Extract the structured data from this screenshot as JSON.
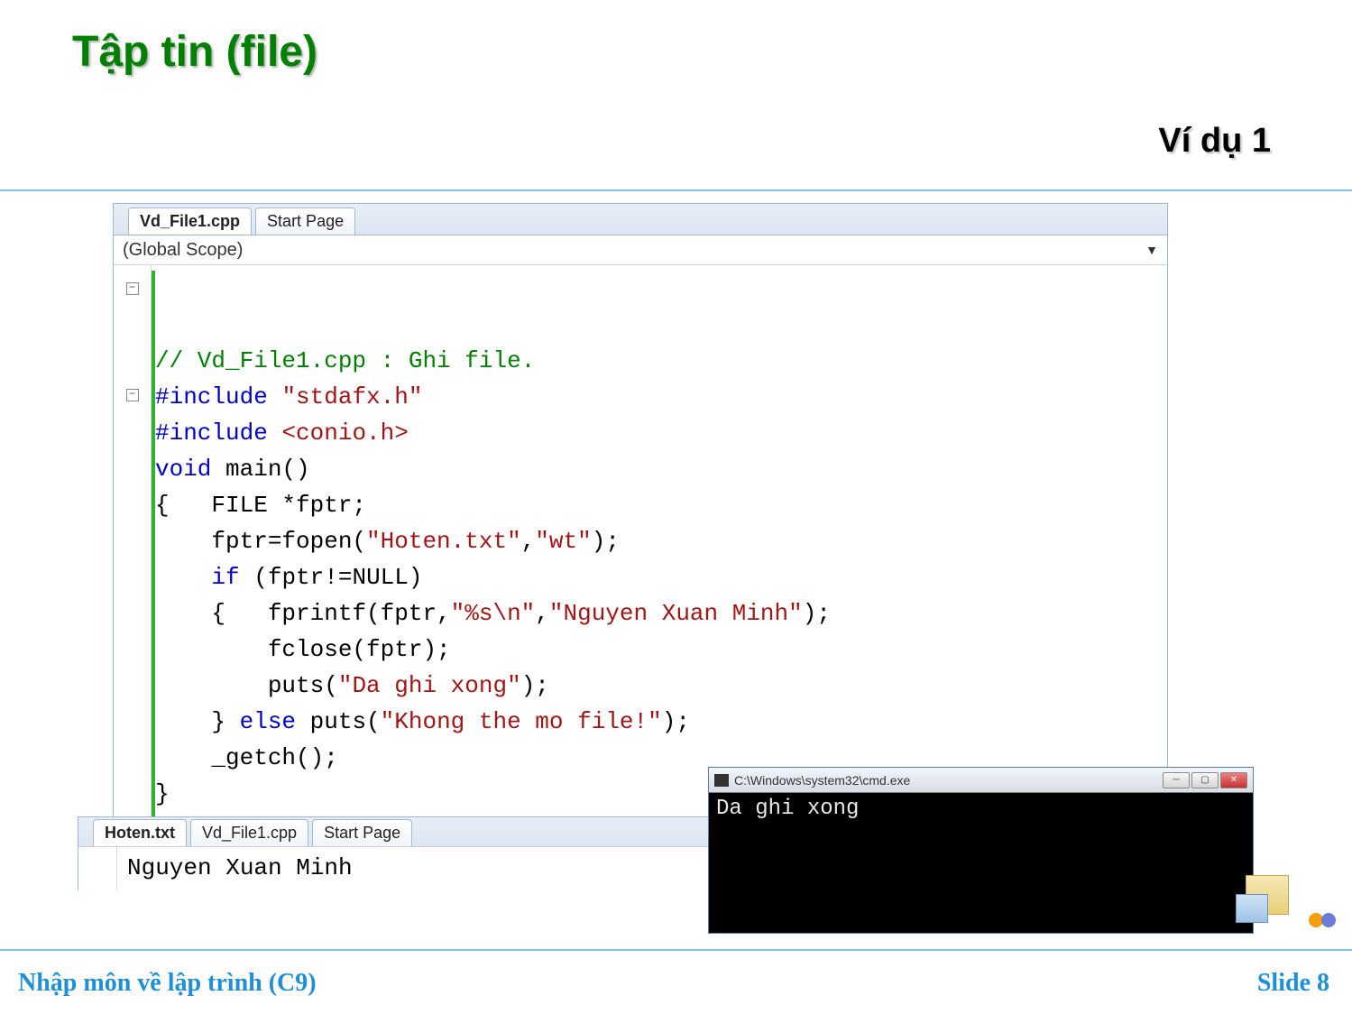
{
  "title": "Tập tin (file)",
  "subtitle": "Ví dụ 1",
  "footer": {
    "left": "Nhập môn về lập trình (C9)",
    "right": "Slide 8"
  },
  "editor1": {
    "tabs": [
      "Vd_File1.cpp",
      "Start Page"
    ],
    "activeTabIndex": 0,
    "scope": "(Global Scope)",
    "code": {
      "l1": {
        "comment": "// Vd_File1.cpp : Ghi file."
      },
      "l2": {
        "kw": "#include ",
        "str": "\"stdafx.h\""
      },
      "l3": {
        "kw": "#include ",
        "str": "<conio.h>"
      },
      "l4": {
        "kw": "void",
        "rest": " main()"
      },
      "l5": "{   FILE *fptr;",
      "l6_a": "    fptr=fopen(",
      "l6_s1": "\"Hoten.txt\"",
      "l6_b": ",",
      "l6_s2": "\"wt\"",
      "l6_c": ");",
      "l7_a": "    ",
      "l7_kw": "if",
      "l7_b": " (fptr!=NULL)",
      "l8_a": "    {   fprintf(fptr,",
      "l8_s1": "\"%s\\n\"",
      "l8_b": ",",
      "l8_s2": "\"Nguyen Xuan Minh\"",
      "l8_c": ");",
      "l9_a": "        fclose(fptr);",
      "l10_a": "        puts(",
      "l10_s": "\"Da ghi xong\"",
      "l10_b": ");",
      "l11_a": "    } ",
      "l11_kw": "else",
      "l11_b": " puts(",
      "l11_s": "\"Khong the mo file!\"",
      "l11_c": ");",
      "l12": "    _getch();",
      "l13": "}"
    }
  },
  "editor2": {
    "tabs": [
      "Hoten.txt",
      "Vd_File1.cpp",
      "Start Page"
    ],
    "activeTabIndex": 0,
    "content": "Nguyen Xuan Minh"
  },
  "console": {
    "title": "C:\\Windows\\system32\\cmd.exe",
    "output": "Da ghi xong"
  },
  "icons": {
    "dropdown": "▼",
    "min": "─",
    "max": "▢",
    "close": "✕",
    "foldMinus": "−"
  }
}
